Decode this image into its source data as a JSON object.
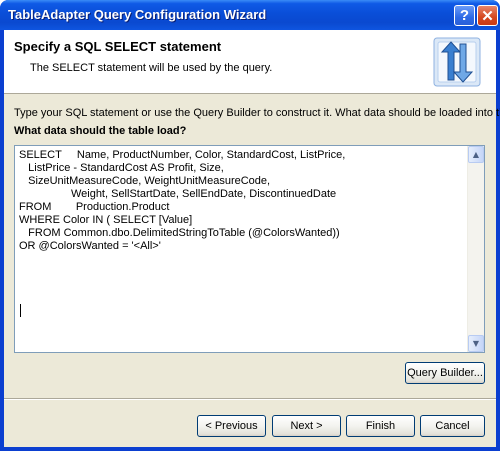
{
  "window": {
    "title": "TableAdapter Query Configuration Wizard"
  },
  "titlebar": {
    "help_label": "?",
    "close_label": "✕"
  },
  "header": {
    "title": "Specify a SQL SELECT statement",
    "subtitle": "The SELECT statement will be used by the query.",
    "icon": "query-wizard-arrows-icon"
  },
  "body": {
    "instruction": "Type your SQL statement or use the Query Builder to construct it. What data should be loaded into the table?",
    "question": "What data should the table load?",
    "sql": "SELECT     Name, ProductNumber, Color, StandardCost, ListPrice,\n   ListPrice - StandardCost AS Profit, Size,\n   SizeUnitMeasureCode, WeightUnitMeasureCode,\n                 Weight, SellStartDate, SellEndDate, DiscontinuedDate\nFROM        Production.Product\nWHERE Color IN ( SELECT [Value]\n   FROM Common.dbo.DelimitedStringToTable (@ColorsWanted))\nOR @ColorsWanted = '<All>'",
    "query_builder_label": "Query Builder..."
  },
  "footer": {
    "previous_label": "< Previous",
    "next_label": "Next >",
    "finish_label": "Finish",
    "cancel_label": "Cancel"
  },
  "colors": {
    "titlebar": "#0a4ed8",
    "dialog_bg": "#ece9d8",
    "button_border": "#003c74",
    "icon_blue": "#3a7fd0"
  }
}
